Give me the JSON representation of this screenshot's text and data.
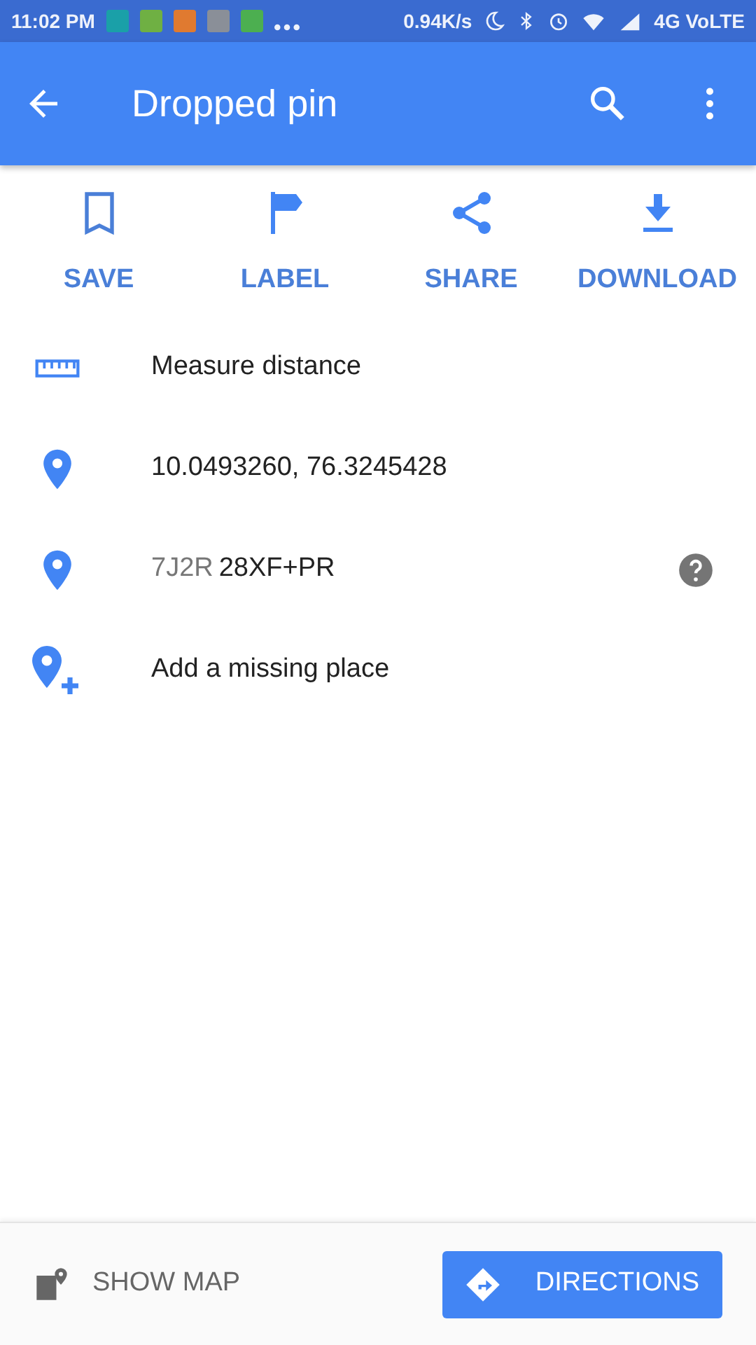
{
  "status_bar": {
    "time": "11:02 PM",
    "notification_icons": [
      {
        "color": "#1aa0a8"
      },
      {
        "color": "#6fb043"
      },
      {
        "color": "#e07a30"
      },
      {
        "color": "#8a8f98"
      },
      {
        "color": "#4caf50"
      }
    ],
    "speed": "0.94K/s",
    "network": "4G VoLTE"
  },
  "app_bar": {
    "title": "Dropped pin"
  },
  "actions": [
    {
      "label": "SAVE",
      "kind": "bookmark"
    },
    {
      "label": "LABEL",
      "kind": "flag"
    },
    {
      "label": "SHARE",
      "kind": "share"
    },
    {
      "label": "DOWNLOAD",
      "kind": "download"
    }
  ],
  "rows": [
    {
      "kind": "ruler",
      "text": "Measure distance"
    },
    {
      "kind": "pin",
      "text": "10.0493260, 76.3245428"
    },
    {
      "kind": "plus-code",
      "prefix": "7J2R",
      "text": "28XF+PR"
    },
    {
      "kind": "pin-add",
      "text": "Add a missing place"
    }
  ],
  "bottom_bar": {
    "show_map": "SHOW MAP",
    "directions": "DIRECTIONS"
  }
}
